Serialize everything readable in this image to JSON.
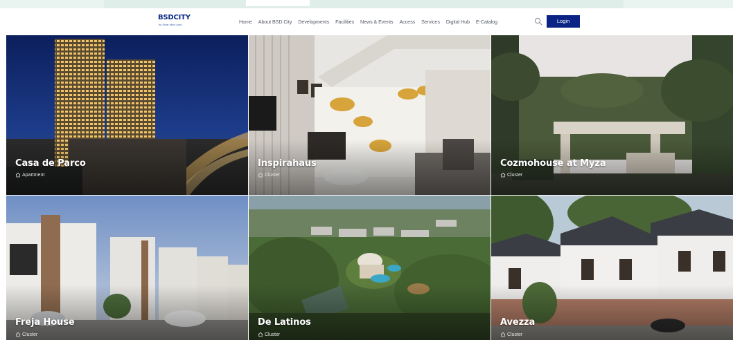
{
  "brand": {
    "logo_text": "BSDCITY",
    "logo_tagline": "by Sinar Mas Land"
  },
  "nav": {
    "items": [
      {
        "label": "Home"
      },
      {
        "label": "About BSD City"
      },
      {
        "label": "Developments"
      },
      {
        "label": "Facilities"
      },
      {
        "label": "News & Events"
      },
      {
        "label": "Access"
      },
      {
        "label": "Services"
      },
      {
        "label": "Digital Hub"
      },
      {
        "label": "E-Catalog"
      }
    ],
    "search_icon": "search-icon",
    "login_label": "Login"
  },
  "colors": {
    "brand": "#0a2384",
    "nav_text": "#555b66",
    "top_strip": "#dfeee8"
  },
  "properties": [
    {
      "name": "Casa de Parco",
      "category": "Apartment",
      "icon": "home-icon"
    },
    {
      "name": "Inspirahaus",
      "category": "Cluster",
      "icon": "home-icon"
    },
    {
      "name": "Cozmohouse at Myza",
      "category": "Cluster",
      "icon": "home-icon"
    },
    {
      "name": "Freja House",
      "category": "Cluster",
      "icon": "home-icon"
    },
    {
      "name": "De Latinos",
      "category": "Cluster",
      "icon": "home-icon"
    },
    {
      "name": "Avezza",
      "category": "Cluster",
      "icon": "home-icon"
    }
  ]
}
